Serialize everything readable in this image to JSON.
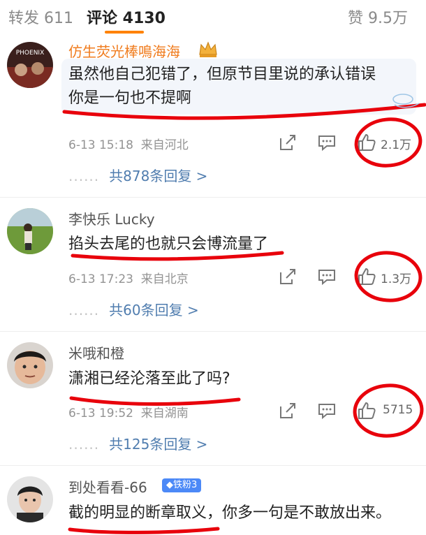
{
  "tabs": {
    "reposts": "转发 611",
    "comments": "评论 4130",
    "likes": "赞 9.5万"
  },
  "colors": {
    "accent": "#ff8200",
    "link": "#507daf",
    "vip_name": "#f07c1e",
    "annotation": "#e8000b"
  },
  "comments": [
    {
      "username": "仿生荧光棒鳴海海",
      "badge_icon": "crown-icon",
      "text_line1": "虽然他自己犯错了，但原节目里说的承认错误",
      "text_line2": "你是一句也不提啊",
      "date": "6-13 15:18",
      "location": "来自河北",
      "likes": "2.1万",
      "replies": "共878条回复 >",
      "dots": "......"
    },
    {
      "username": "李快乐 Lucky",
      "text_line1": "掐头去尾的也就只会博流量了",
      "date": "6-13 17:23",
      "location": "来自北京",
      "likes": "1.3万",
      "replies": "共60条回复 >",
      "dots": "......"
    },
    {
      "username": "米哦和橙",
      "text_line1": "潇湘已经沦落至此了吗?",
      "date": "6-13 19:52",
      "location": "来自湖南",
      "likes": "5715",
      "replies": "共125条回复 >",
      "dots": "......"
    },
    {
      "username": "到处看看-66",
      "fan_badge": "◆铁粉3",
      "text_line1": "截的明显的断章取义，你多一句是不敢放出来。"
    }
  ]
}
